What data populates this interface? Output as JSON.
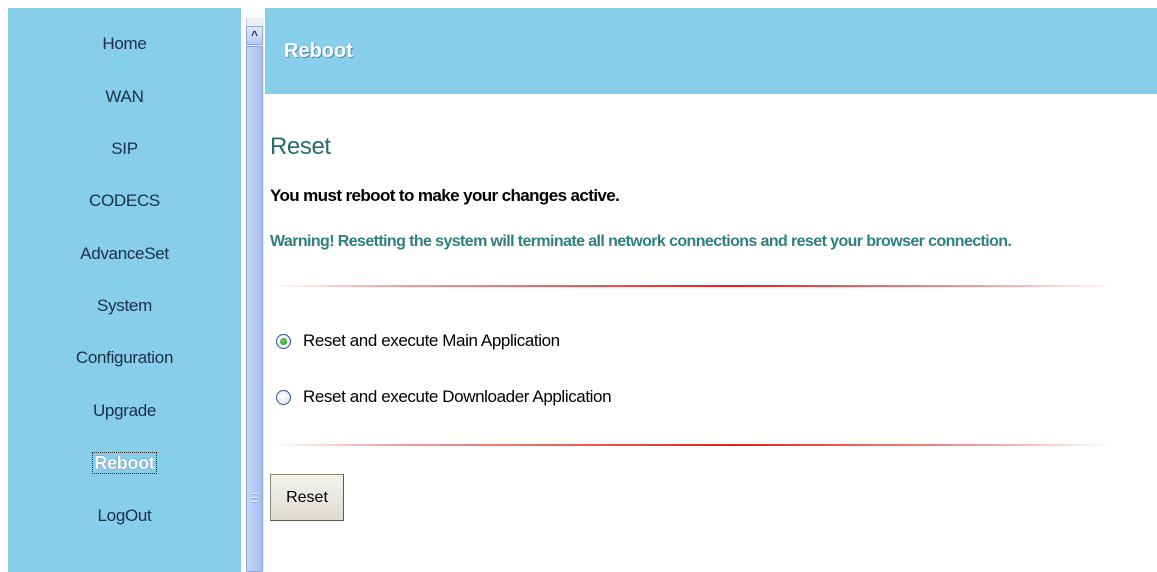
{
  "sidebar": {
    "items": [
      {
        "label": "Home"
      },
      {
        "label": "WAN"
      },
      {
        "label": "SIP"
      },
      {
        "label": "CODECS"
      },
      {
        "label": "AdvanceSet"
      },
      {
        "label": "System"
      },
      {
        "label": "Configuration"
      },
      {
        "label": "Upgrade"
      },
      {
        "label": "Reboot",
        "active": true
      },
      {
        "label": "LogOut"
      }
    ]
  },
  "scrollbar": {
    "up_arrow_glyph": "^"
  },
  "header": {
    "title": "Reboot"
  },
  "main": {
    "section_title": "Reset",
    "message": "You must reboot to make your changes active.",
    "warning": "Warning! Resetting the system will terminate all network connections and reset your browser connection.",
    "options": [
      {
        "label": "Reset and execute Main Application",
        "selected": true
      },
      {
        "label": "Reset and execute Downloader Application",
        "selected": false
      }
    ],
    "reset_button": "Reset"
  },
  "colors": {
    "nav_background": "#87ceeb",
    "header_background": "#87ceeb",
    "section_title": "#2c6b6b",
    "warning_text": "#2f7f7f",
    "divider_red": "#e52020"
  }
}
